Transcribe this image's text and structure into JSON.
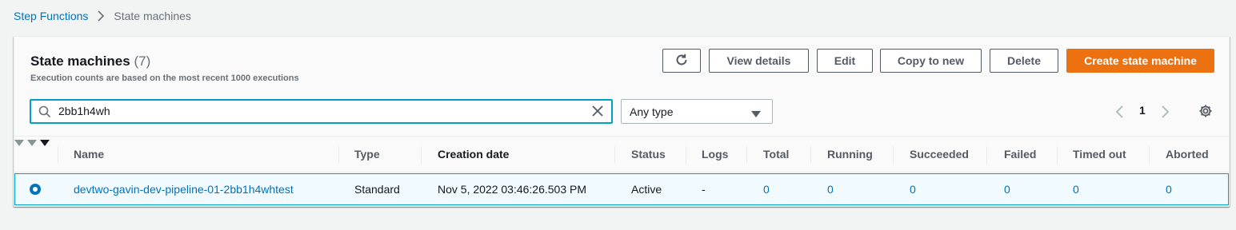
{
  "breadcrumb": {
    "root": "Step Functions",
    "current": "State machines"
  },
  "panel": {
    "title": "State machines",
    "count": "(7)",
    "subtitle": "Execution counts are based on the most recent 1000 executions"
  },
  "actions": {
    "refresh_icon": "refresh-icon",
    "view_details": "View details",
    "edit": "Edit",
    "copy_to_new": "Copy to new",
    "delete": "Delete",
    "create": "Create state machine"
  },
  "filter": {
    "search_value": "2bb1h4wh",
    "search_icon": "search-icon",
    "clear_icon": "close-icon",
    "type_selected": "Any type"
  },
  "pagination": {
    "current_page": "1"
  },
  "table": {
    "columns": {
      "name": "Name",
      "type": "Type",
      "creation_date": "Creation date",
      "status": "Status",
      "logs": "Logs",
      "total": "Total",
      "running": "Running",
      "succeeded": "Succeeded",
      "failed": "Failed",
      "timed_out": "Timed out",
      "aborted": "Aborted"
    },
    "rows": [
      {
        "name": "devtwo-gavin-dev-pipeline-01-2bb1h4whtest",
        "type": "Standard",
        "creation_date": "Nov 5, 2022 03:46:26.503 PM",
        "status": "Active",
        "logs": "-",
        "total": "0",
        "running": "0",
        "succeeded": "0",
        "failed": "0",
        "timed_out": "0",
        "aborted": "0"
      }
    ]
  },
  "colors": {
    "link": "#0073bb",
    "primary": "#ec7211",
    "focus": "#00a1c9",
    "selected_row_bg": "#f1faff"
  }
}
